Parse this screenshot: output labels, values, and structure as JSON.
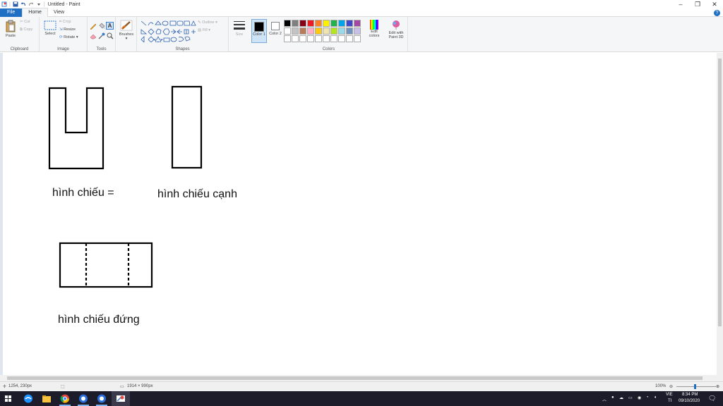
{
  "window": {
    "title": "Untitled - Paint"
  },
  "tabs": {
    "file": "File",
    "home": "Home",
    "view": "View"
  },
  "clipboard": {
    "paste": "Paste",
    "cut": "Cut",
    "copy": "Copy",
    "label": "Clipboard"
  },
  "image": {
    "select": "Select",
    "crop": "Crop",
    "resize": "Resize",
    "rotate": "Rotate",
    "label": "Image"
  },
  "tools": {
    "label": "Tools"
  },
  "brushes": {
    "label": "Brushes"
  },
  "shapes": {
    "outline": "Outline",
    "fill": "Fill",
    "label": "Shapes"
  },
  "size": {
    "label": "Size"
  },
  "colors": {
    "color1": "Color 1",
    "color2": "Color 2",
    "edit_colors": "Edit colors",
    "paint3d": "Edit with Paint 3D",
    "label": "Colors",
    "palette_row1": [
      "#000000",
      "#7f7f7f",
      "#880015",
      "#ed1c24",
      "#ff7f27",
      "#fff200",
      "#22b14c",
      "#00a2e8",
      "#3f48cc",
      "#a349a4"
    ],
    "palette_row2": [
      "#ffffff",
      "#c3c3c3",
      "#b97a57",
      "#ffaec9",
      "#ffc90e",
      "#efe4b0",
      "#b5e61d",
      "#99d9ea",
      "#7092be",
      "#c8bfe7"
    ]
  },
  "canvas_labels": {
    "label1": "hình chiếu =",
    "label2": "hình chiếu cạnh",
    "label3": "hình chiếu đứng"
  },
  "statusbar": {
    "cursor": "1254, 230px",
    "dimensions": "1914 × 990px",
    "zoom": "100%"
  },
  "taskbar": {
    "lang1": "VIE",
    "lang2": "TI",
    "time": "8:34 PM",
    "date": "09/10/2020"
  }
}
